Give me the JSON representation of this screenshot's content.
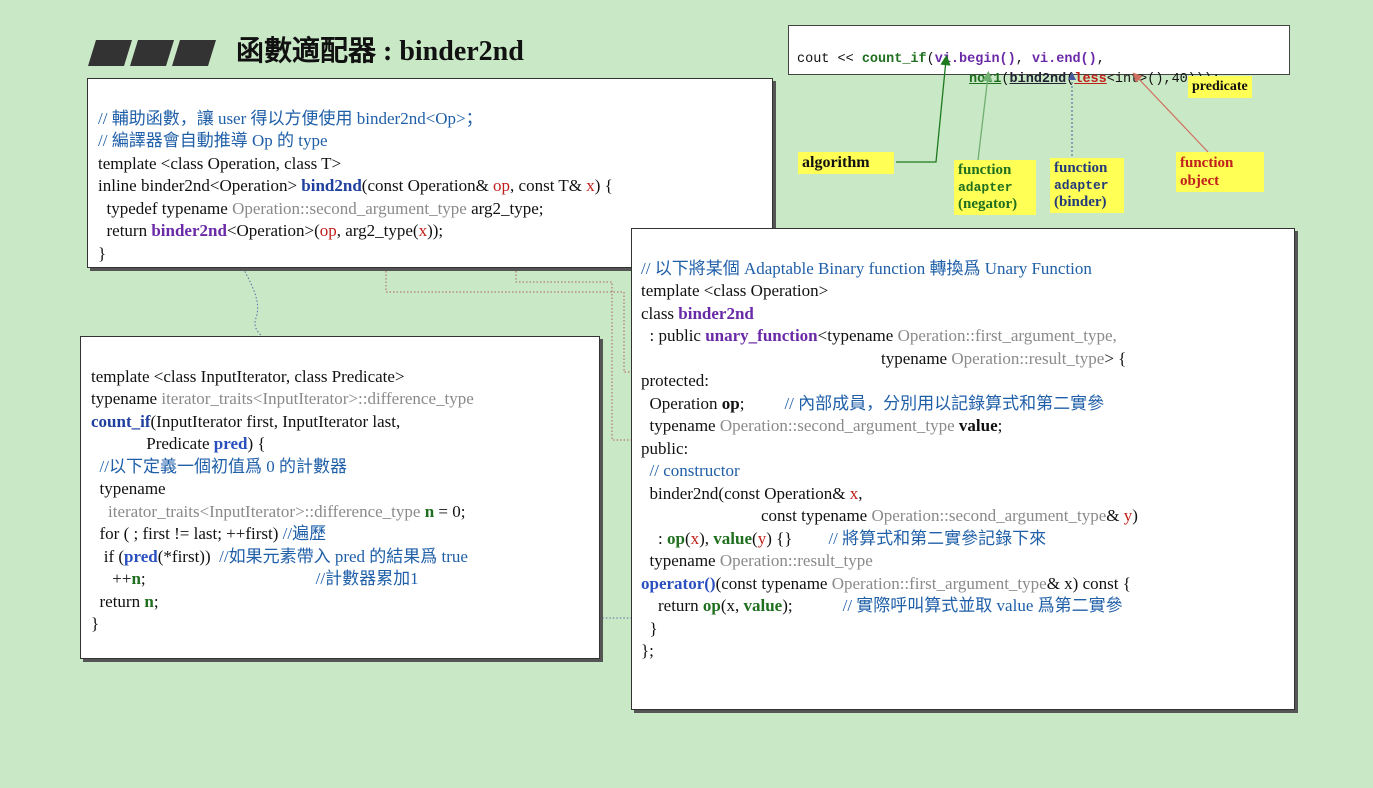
{
  "title": "函數適配器 : binder2nd",
  "top_box": {
    "line1_a": "cout << ",
    "line1_b": "count_if",
    "line1_c": "(",
    "line1_d": "vi.begin()",
    "line1_e": ", ",
    "line1_f": "vi.end()",
    "line1_g": ",",
    "line2_a": "not1",
    "line2_b": "(",
    "line2_c": "bind2nd",
    "line2_d": "(",
    "line2_e": "less",
    "line2_f": "<int>()",
    "line2_g": ",40)));"
  },
  "labels": {
    "predicate": "predicate",
    "algorithm": "algorithm",
    "fa_negator": [
      "function",
      "adapter",
      "(negator)"
    ],
    "fa_binder": [
      "function",
      "adapter",
      "(binder)"
    ],
    "fobj": [
      "function",
      "object"
    ]
  },
  "box1": {
    "l1": "// 輔助函數，讓 user 得以方便使用 binder2nd<Op>；",
    "l2": "// 編譯器會自動推導 Op 的 type",
    "l3": "template <class Operation, class T>",
    "l4_a": "inline binder2nd<Operation> ",
    "l4_b": "bind2nd",
    "l4_c": "(const Operation& ",
    "l4_d": "op",
    "l4_e": ", const T& ",
    "l4_f": "x",
    "l4_g": ") {",
    "l5_a": "  typedef typename ",
    "l5_b": "Operation::second_argument_type",
    "l5_c": " arg2_type;",
    "l6_a": "  return ",
    "l6_b": "binder2nd",
    "l6_c": "<Operation>(",
    "l6_d": "op",
    "l6_e": ", arg2_type(",
    "l6_f": "x",
    "l6_g": "));",
    "l7": "}"
  },
  "box2": {
    "l1": "template <class InputIterator, class Predicate>",
    "l2_a": "typename ",
    "l2_b": "iterator_traits<InputIterator>::difference_type",
    "l3_a": "count_if",
    "l3_b": "(InputIterator first, InputIterator last,",
    "l4_a": "             Predicate ",
    "l4_b": "pred",
    "l4_c": ") {",
    "l5": "  //以下定義一個初值爲 0 的計數器",
    "l6": "  typename",
    "l7_a": "    ",
    "l7_b": "iterator_traits<InputIterator>::difference_type",
    "l7_c": " n",
    "l7_d": " = 0;",
    "l8_a": "  for ( ; first != last; ++first) ",
    "l8_b": "//遍歷",
    "l9_a": "   if (",
    "l9_b": "pred",
    "l9_c": "(*first))  ",
    "l9_d": "//如果元素帶入 pred 的結果爲 true",
    "l10_a": "     ++",
    "l10_b": "n",
    "l10_c": ";",
    "l10_d": "//計數器累加1",
    "l11_a": "  return ",
    "l11_b": "n",
    "l11_c": ";",
    "l12": "}"
  },
  "box3": {
    "l1": "// 以下將某個 Adaptable Binary function 轉換爲 Unary Function",
    "l2": "template <class Operation>",
    "l3_a": "class ",
    "l3_b": "binder2nd",
    "l4_a": "  : public ",
    "l4_b": "unary_function",
    "l4_c": "<typename ",
    "l4_d": "Operation::first_argument_type,",
    "l5_a": "typename ",
    "l5_b": "Operation::result_type",
    "l5_c": "> {",
    "l6": "protected:",
    "l7_a": "  Operation ",
    "l7_b": "op",
    "l7_c": ";",
    "l7_d": "// 內部成員，分別用以記錄算式和第二實參",
    "l8_a": "  typename ",
    "l8_b": "Operation::second_argument_type",
    "l8_c": " value",
    "l8_d": ";",
    "l9": "public:",
    "l10": "  // constructor",
    "l11_a": "  binder2nd(const Operation& ",
    "l11_b": "x",
    "l11_c": ",",
    "l12_a": "const typename ",
    "l12_b": "Operation::second_argument_type",
    "l12_c": "& ",
    "l12_d": "y",
    "l12_e": ")",
    "l13_a": "    : ",
    "l13_b": "op",
    "l13_c": "(",
    "l13_d": "x",
    "l13_e": "), ",
    "l13_f": "value",
    "l13_g": "(",
    "l13_h": "y",
    "l13_i": ") {}",
    "l13_j": "// 將算式和第二實參記錄下來",
    "l14_a": "  typename ",
    "l14_b": "Operation::result_type",
    "l15_a": "operator()",
    "l15_b": "(const typename ",
    "l15_c": "Operation::first_argument_type",
    "l15_d": "& x) const {",
    "l16_a": "    return ",
    "l16_b": "op",
    "l16_c": "(x, ",
    "l16_d": "value",
    "l16_e": ");",
    "l16_f": "// 實際呼叫算式並取 value 爲第二實參",
    "l17": "  }",
    "l18": "};"
  },
  "colors": {
    "background": "#c9e8c6",
    "comment": "#1f5fa8",
    "keyword_purple": "#6a2aa8",
    "red": "#c0201a",
    "green": "#1f6f1f",
    "label_yellow": "#ffff55"
  }
}
